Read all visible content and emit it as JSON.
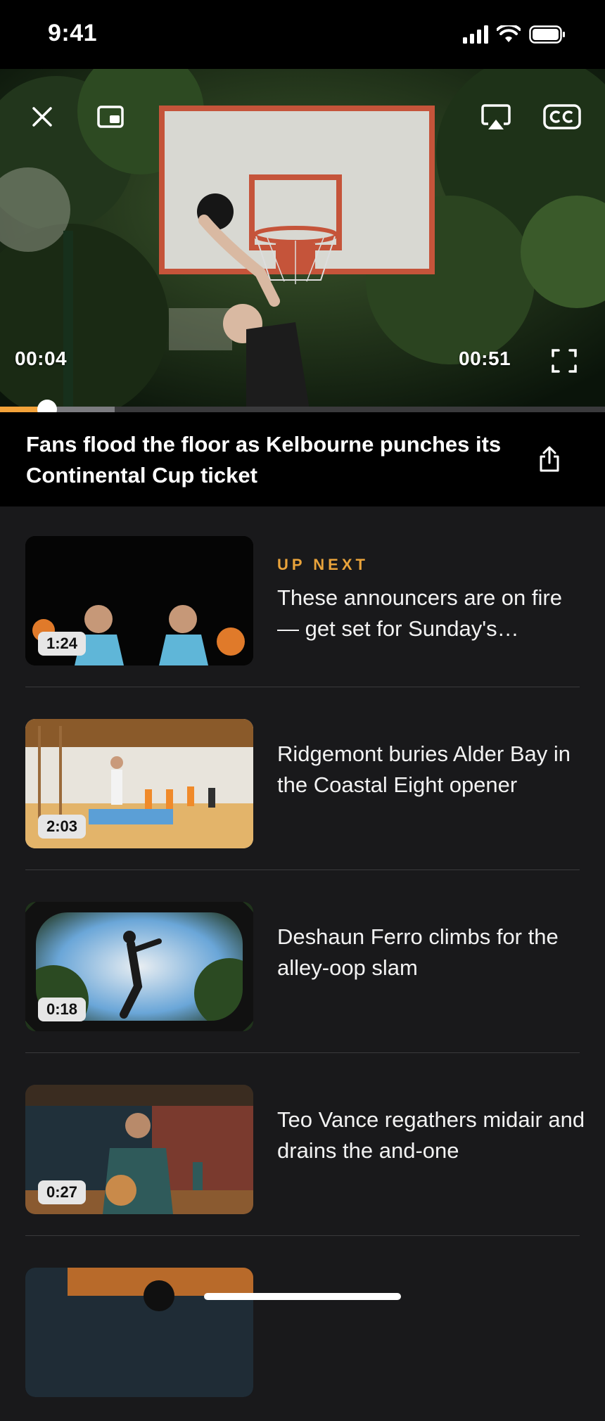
{
  "status_bar": {
    "time": "9:41",
    "icons": [
      "signal-icon",
      "wifi-icon",
      "battery-icon"
    ]
  },
  "player": {
    "controls": {
      "close": "close-icon",
      "pip": "picture-in-picture-icon",
      "airplay": "airplay-icon",
      "captions": "closed-captions-icon",
      "fullscreen": "fullscreen-icon"
    },
    "elapsed": "00:04",
    "remaining": "00:51",
    "progress": 0.078,
    "buffered": 0.19
  },
  "now_playing": {
    "title": "Fans flood the floor as Kelbourne punches its Continental Cup ticket",
    "share_icon": "share-icon"
  },
  "up_next_label": "UP NEXT",
  "videos": [
    {
      "duration": "1:24",
      "title": "These announcers are on fire — get set for Sunday's…"
    },
    {
      "duration": "2:03",
      "title": "Ridgemont buries Alder Bay in the Coastal Eight opener"
    },
    {
      "duration": "0:18",
      "title": "Deshaun Ferro climbs for the alley-oop slam"
    },
    {
      "duration": "0:27",
      "title": "Teo Vance regathers midair and drains the and-one"
    }
  ],
  "colors": {
    "accent": "#f2a23a",
    "up_next": "#e9a33b",
    "background": "#19191b"
  }
}
